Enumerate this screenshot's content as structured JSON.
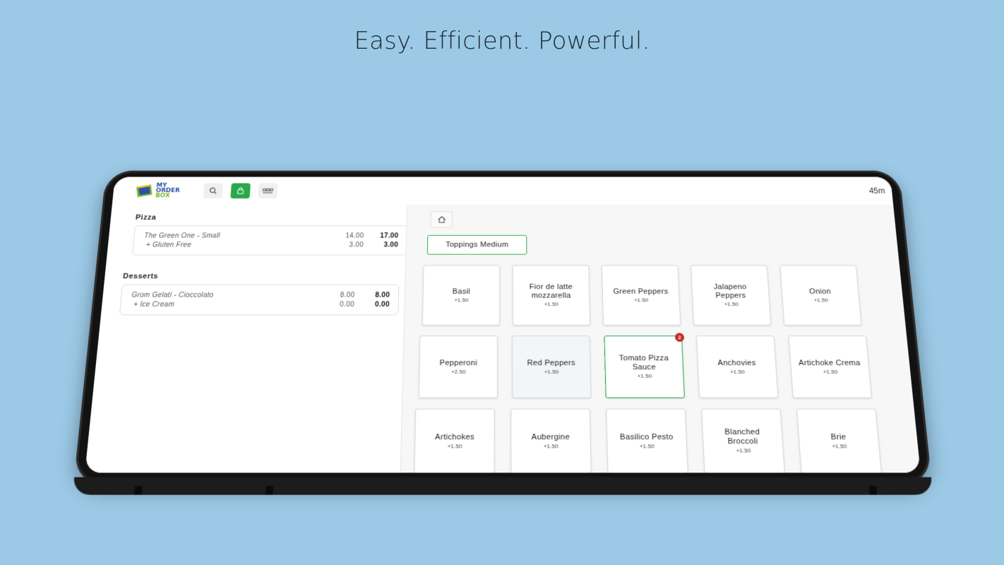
{
  "headline": "Easy. Efficient. Powerful.",
  "app": {
    "logo": {
      "line1": "MY",
      "line2": "ORDER",
      "line3": "BOX"
    },
    "timer": "45m",
    "colors": {
      "accent": "#2aa84a",
      "badge": "#c62828",
      "power": "#d32f2f"
    }
  },
  "order": {
    "groups": [
      {
        "title": "Pizza",
        "lines": [
          {
            "name": "The Green One - Small",
            "unit": "14.00",
            "total": "17.00"
          },
          {
            "name": "+ Gluten Free",
            "unit": "3.00",
            "total": "3.00"
          }
        ]
      },
      {
        "title": "Desserts",
        "lines": [
          {
            "name": "Grom Gelati - Cioccolato",
            "unit": "8.00",
            "total": "8.00"
          },
          {
            "name": "+ Ice Cream",
            "unit": "0.00",
            "total": "0.00"
          }
        ]
      }
    ]
  },
  "menu": {
    "category": "Toppings Medium",
    "items": [
      {
        "name": "Basil",
        "price": "+1.50"
      },
      {
        "name": "Fior de latte mozzarella",
        "price": "+1.50"
      },
      {
        "name": "Green Peppers",
        "price": "+1.50"
      },
      {
        "name": "Jalapeno Peppers",
        "price": "+1.50"
      },
      {
        "name": "Onion",
        "price": "+1.50"
      },
      {
        "name": "Pepperoni",
        "price": "+2.50"
      },
      {
        "name": "Red Peppers",
        "price": "+1.50"
      },
      {
        "name": "Tomato Pizza Sauce",
        "price": "+1.50",
        "count": "2"
      },
      {
        "name": "Anchovies",
        "price": "+1.50"
      },
      {
        "name": "Artichoke Crema",
        "price": "+1.50"
      },
      {
        "name": "Artichokes",
        "price": "+1.50"
      },
      {
        "name": "Aubergine",
        "price": "+1.50"
      },
      {
        "name": "Basilico Pesto",
        "price": "+1.50"
      },
      {
        "name": "Blanched Broccoli",
        "price": "+1.50"
      },
      {
        "name": "Brie",
        "price": "+1.50"
      }
    ]
  }
}
